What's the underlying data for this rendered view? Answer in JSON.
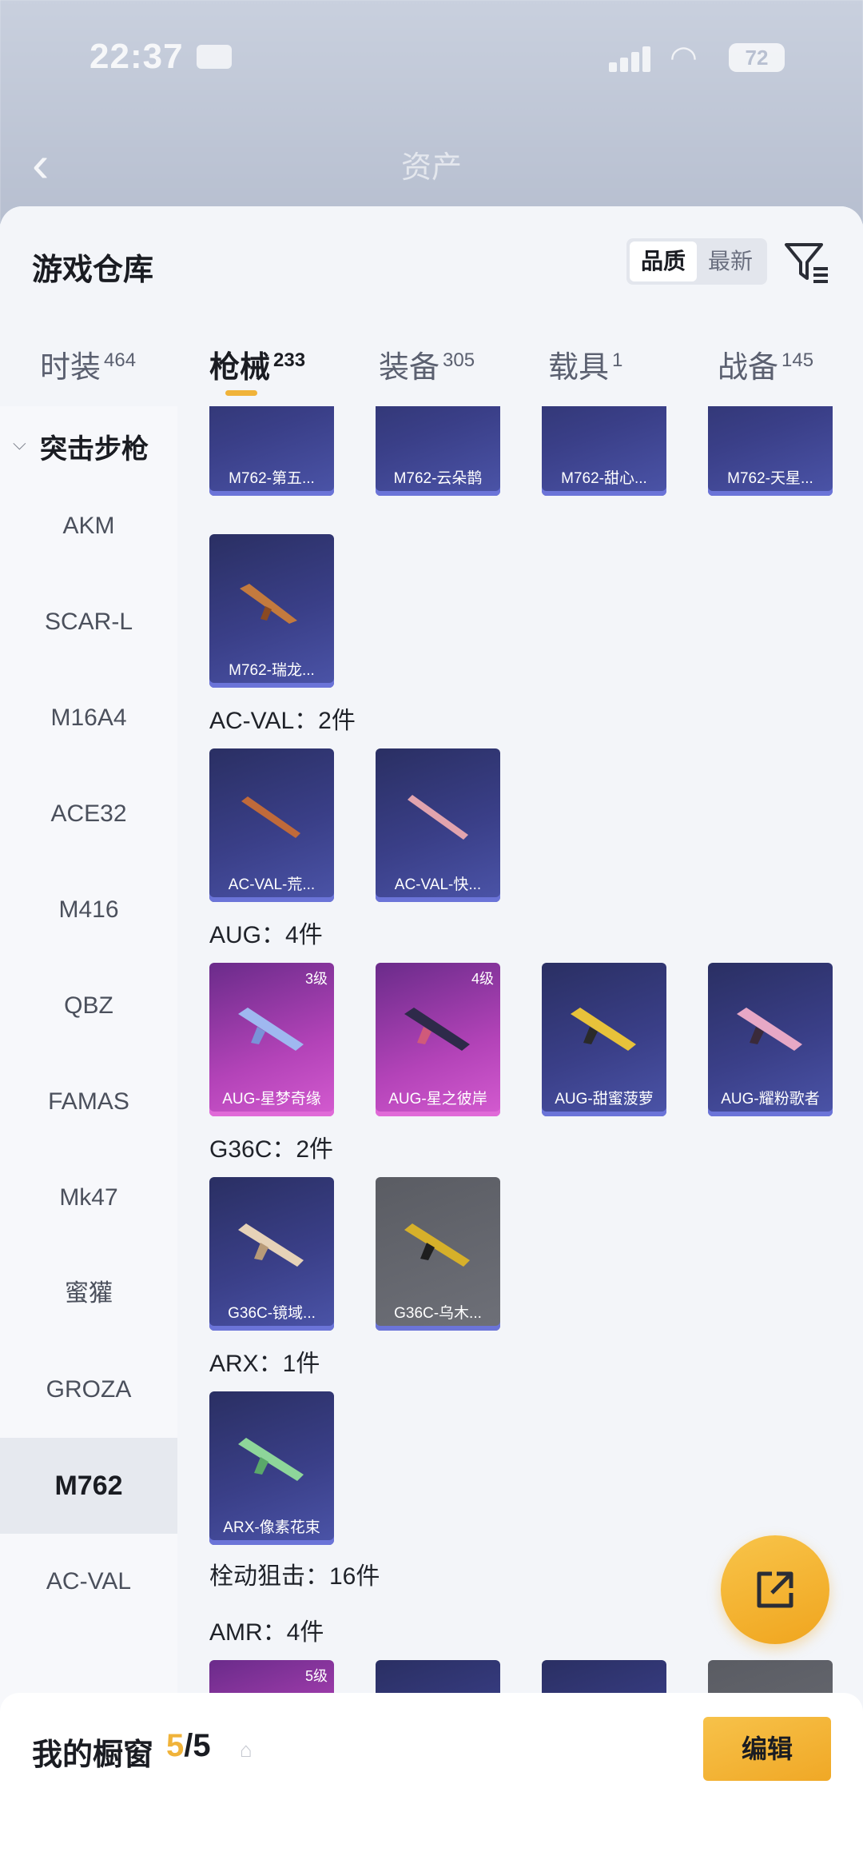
{
  "status_bar": {
    "time": "22:37",
    "battery": "72"
  },
  "background_header": {
    "title": "资产"
  },
  "sheet": {
    "title": "游戏仓库",
    "sort": {
      "options": [
        "品质",
        "最新"
      ],
      "active": "品质"
    }
  },
  "tabs": [
    {
      "label": "时装",
      "count": "464"
    },
    {
      "label": "枪械",
      "count": "233"
    },
    {
      "label": "装备",
      "count": "305"
    },
    {
      "label": "载具",
      "count": "1"
    },
    {
      "label": "战备",
      "count": "145"
    }
  ],
  "active_tab": "枪械",
  "sidebar": {
    "group": "突击步枪",
    "items": [
      "AKM",
      "SCAR-L",
      "M16A4",
      "ACE32",
      "M416",
      "QBZ",
      "FAMAS",
      "Mk47",
      "蜜獾",
      "GROZA",
      "M762",
      "AC-VAL"
    ],
    "active": "M762"
  },
  "sections": {
    "m762_row1": [
      "M762-第五...",
      "M762-云朵鹊",
      "M762-甜心...",
      "M762-天星..."
    ],
    "m762_row2": [
      "M762-瑞龙..."
    ],
    "acval": {
      "label": "AC-VAL：2件",
      "items": [
        "AC-VAL-荒...",
        "AC-VAL-快..."
      ]
    },
    "aug": {
      "label": "AUG：4件",
      "items": [
        {
          "name": "AUG-星梦奇缘",
          "level": "3级"
        },
        {
          "name": "AUG-星之彼岸",
          "level": "4级"
        },
        {
          "name": "AUG-甜蜜菠萝",
          "level": ""
        },
        {
          "name": "AUG-耀粉歌者",
          "level": ""
        }
      ]
    },
    "g36c": {
      "label": "G36C：2件",
      "items": [
        "G36C-镜域...",
        "G36C-乌木..."
      ]
    },
    "arx": {
      "label": "ARX：1件",
      "items": [
        "ARX-像素花束"
      ]
    },
    "bolt_sniper": {
      "label": "栓动狙击：16件"
    },
    "amr": {
      "label": "AMR：4件",
      "first_level": "5级"
    }
  },
  "bottom_bar": {
    "title": "我的橱窗",
    "count_current": "5",
    "count_total": "/5",
    "edit_label": "编辑"
  },
  "colors": {
    "accent": "#f0b33a",
    "card_blue": "#3a3f88",
    "card_pink": "#b343b8"
  }
}
